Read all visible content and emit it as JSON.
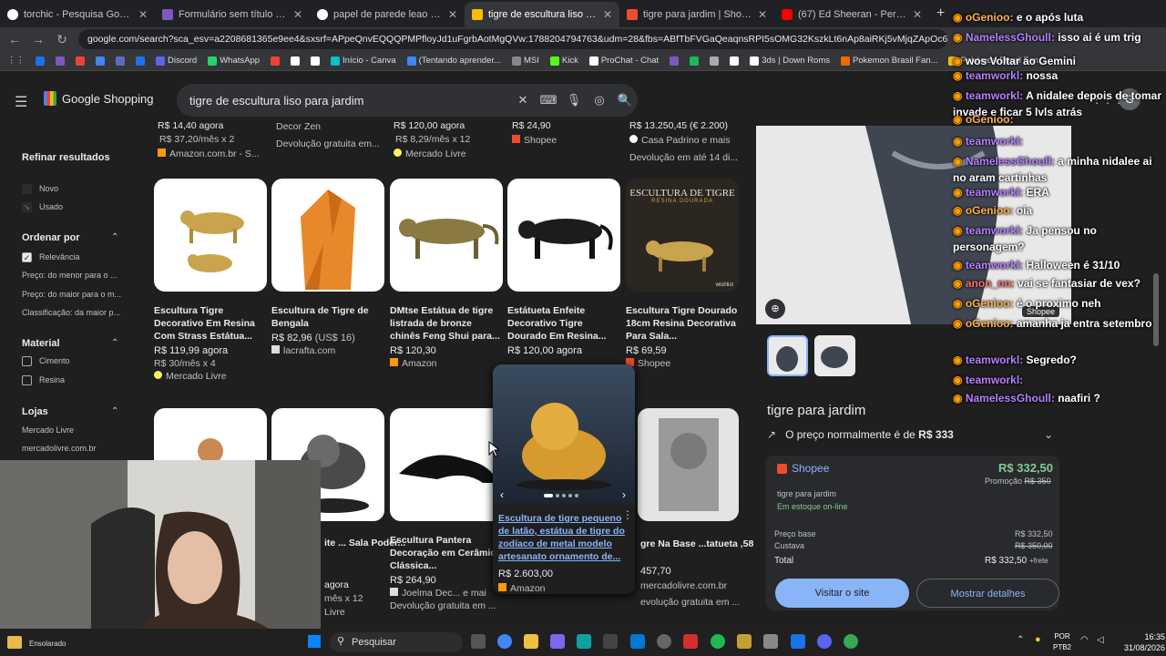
{
  "tabs": [
    {
      "title": "torchic - Pesquisa Google",
      "color": "#ffffff"
    },
    {
      "title": "Formulário sem título - Google",
      "color": "#7e57c2"
    },
    {
      "title": "papel de parede leao - Pesquis",
      "color": "#ffffff"
    },
    {
      "title": "tigre de escultura liso para jardi",
      "color": "#fbbc05",
      "active": true
    },
    {
      "title": "tigre para jardim | Shopee Brasi",
      "color": "#ee4d2d"
    },
    {
      "title": "(67) Ed Sheeran - Perfeita - You",
      "color": "#ff0000"
    }
  ],
  "address": "google.com/search?sca_esv=a2208681365e9ee4&sxsrf=APpeQnvEQQQPMPfloyJd1uFgrbAotMgQVw:1788204794763&udm=28&fbs=ABfTbFVGaQeaqnsRPI5sOMG32KszkLt6nAp8aiRKj5vMjqZApOc6yfvD6e0PKT-w9T4UNd5LfevPP...",
  "bookmarks": [
    {
      "label": "",
      "color": "#1a73e8"
    },
    {
      "label": "",
      "color": "#7e57c2"
    },
    {
      "label": "",
      "color": "#ea4335"
    },
    {
      "label": "",
      "color": "#4285f4"
    },
    {
      "label": "",
      "color": "#5c6bc0"
    },
    {
      "label": "",
      "color": "#1a73e8"
    },
    {
      "label": "Discord",
      "color": "#5865f2"
    },
    {
      "label": "WhatsApp",
      "color": "#25d366"
    },
    {
      "label": "",
      "color": "#ea4335"
    },
    {
      "label": "",
      "color": "#ffffff"
    },
    {
      "label": "",
      "color": "#ffffff"
    },
    {
      "label": "Início - Canva",
      "color": "#00c4cc"
    },
    {
      "label": "(Tentando aprender...",
      "color": "#4285f4"
    },
    {
      "label": "MSI",
      "color": "#888888"
    },
    {
      "label": "Kick",
      "color": "#53fc18"
    },
    {
      "label": "ProChat - Chat",
      "color": "#ffffff"
    },
    {
      "label": "",
      "color": "#7e57c2"
    },
    {
      "label": "",
      "color": "#1db954"
    },
    {
      "label": "",
      "color": "#aaaaaa"
    },
    {
      "label": "",
      "color": "#ffffff"
    },
    {
      "label": "3ds | Down Roms",
      "color": "#ffffff"
    },
    {
      "label": "Pokemon Brasil Fan...",
      "color": "#ef6c00"
    },
    {
      "label": "Pokémon Brasil Fan...",
      "color": "#fbbc05"
    }
  ],
  "header": {
    "logo_text": "Google Shopping",
    "query": "tigre de escultura liso para jardim",
    "avatar": "G"
  },
  "sidebar": {
    "refine_title": "Refinar resultados",
    "condition": [
      "Novo",
      "Usado"
    ],
    "sort_title": "Ordenar por",
    "sort": [
      "Relevância",
      "Preço: do menor para o ...",
      "Preço: do maior para o m...",
      "Classificação: da maior p..."
    ],
    "material_title": "Material",
    "material": [
      "Cimento",
      "Resina"
    ],
    "stores_title": "Lojas",
    "stores": [
      "Mercado Livre",
      "mercadolivre.com.br"
    ]
  },
  "top_partial": [
    {
      "price": "R$ 14,40 agora",
      "sub": "R$ 37,20/mês x 2",
      "seller": "Amazon.com.br - S..."
    },
    {
      "price": "",
      "sub": "Decor Zen",
      "seller": "Devolução gratuita em..."
    },
    {
      "price": "R$ 120,00 agora",
      "sub": "R$ 8,29/mês x 12",
      "seller": "Mercado Livre"
    },
    {
      "price": "R$ 24,90",
      "sub": "Shopee",
      "seller": ""
    },
    {
      "price": "R$ 13.250,45  (€ 2.200)",
      "sub": "Casa Padrino e mais",
      "seller": "Devolução em até 14 di..."
    }
  ],
  "row1": [
    {
      "title": "Escultura Tigre Decorativo Em Resina Com Strass Estátua...",
      "price": "R$ 119,99 agora",
      "sub": "R$ 30/mês x 4",
      "seller": "Mercado Livre"
    },
    {
      "title": "Escultura de Tigre de Bengala",
      "price": "R$ 82,96",
      "price_extra": "(US$ 16)",
      "sub": "lacrafta.com",
      "seller": ""
    },
    {
      "title": "DMtse Estátua de tigre listrada de bronze chinês Feng Shui para...",
      "price": "R$ 120,30",
      "sub": "Amazon",
      "seller": ""
    },
    {
      "title": "Estátueta Enfeite Decorativo Tigre Dourado Em Resina...",
      "price": "R$ 120,00 agora",
      "sub": "",
      "seller": ""
    },
    {
      "title": "Escultura Tigre Dourado 18cm Resina Decorativa Para Sala...",
      "price": "R$ 69,59",
      "sub": "Shopee",
      "seller": ""
    }
  ],
  "row1_overlay": {
    "line1": "ESCULTURA DE TIGRE",
    "line2": "RESINA DOURADA",
    "tag": "wishlist"
  },
  "row2": [
    {
      "title": "",
      "price": "",
      "sub": ""
    },
    {
      "title": "ite ... Sala Poder...",
      "price": "agora",
      "sub": "mês x 12",
      "seller": "Livre"
    },
    {
      "title": "Escultura Pantera Decoração em Cerâmica Clássica...",
      "price": "R$ 264,90",
      "sub": "Joelma Dec...",
      "sub2": "e mai",
      "seller": "Devolução gratuita em ..."
    },
    {
      "title": "gre Na Base ...tatueta ,58 Cm",
      "price": "457,70",
      "sub": "mercadolivre.com.br",
      "seller": "evolução gratuita em ..."
    }
  ],
  "hover_card": {
    "title": "Escultura de tigre pequeno de latão, estátua de tigre do zodíaco de metal modelo artesanato ornamento de...",
    "price": "R$ 2.603,00",
    "seller": "Amazon"
  },
  "panel": {
    "shop_tag": "Shopee",
    "name": "tigre para jardim",
    "normal_price_text": "O preço normalmente é de",
    "normal_price": "R$ 333",
    "store": "Shopee",
    "price": "R$ 332,50",
    "promo_label": "Promoção",
    "promo_old": "R$ 350",
    "item": "tigre para jardim",
    "stock": "Em estoque on-line",
    "base_label": "Preço base",
    "base_value": "R$ 332,50",
    "cost_label": "Custava",
    "cost_value": "R$ 350,00",
    "total_label": "Total",
    "total_value": "R$ 332,50",
    "shipping": "+frete",
    "visit": "Visitar o site",
    "details": "Mostrar detalhes",
    "accent": "#8ab4f8"
  },
  "chat": [
    {
      "user": "oGenioo:",
      "text": "e o após luta",
      "color": "#ffb14c"
    },
    {
      "user": "NamelessGhoull:",
      "text": "isso ai é um trig",
      "color": "#b780ff"
    },
    {
      "user": "wos",
      "text": "Voltar ao Gemini",
      "color": "#ffffff"
    },
    {
      "user": "teamworkl:",
      "text": "nossa",
      "color": "#b780ff"
    },
    {
      "user": "teamworkl:",
      "text": "A nidalee depois de tomar invade e ficar 5 lvls atrás",
      "color": "#b780ff"
    },
    {
      "user": "oGenioo:",
      "text": "",
      "color": "#ffb14c"
    },
    {
      "user": "teamworkl:",
      "text": "",
      "color": "#b780ff"
    },
    {
      "user": "NamelessGhoull:",
      "text": "a minha nidalee ai no aram cartinhas",
      "color": "#b780ff"
    },
    {
      "user": "teamworkl:",
      "text": "ERA",
      "color": "#b780ff"
    },
    {
      "user": "oGenioo:",
      "text": "oia",
      "color": "#ffb14c"
    },
    {
      "user": "teamworkl:",
      "text": "Ja pensou no personagem?",
      "color": "#b780ff"
    },
    {
      "user": "teamworkl:",
      "text": "Halloween é 31/10",
      "color": "#b780ff"
    },
    {
      "user": "anon_nn:",
      "text": "vai se fantasiar de vex?",
      "color": "#ff6b6b"
    },
    {
      "user": "oGenioo:",
      "text": "é o proximo neh",
      "color": "#ffb14c"
    },
    {
      "user": "oGenioo:",
      "text": "amanha ja entra setembro",
      "color": "#ffb14c"
    },
    {
      "user": "teamworkl:",
      "text": "Segredo?",
      "color": "#b780ff"
    },
    {
      "user": "teamworkl:",
      "text": "",
      "color": "#b780ff"
    },
    {
      "user": "NamelessGhoull:",
      "text": "naafiri ?",
      "color": "#b780ff"
    }
  ],
  "webcam": {
    "label": "Ensolarado"
  },
  "taskbar": {
    "search": "Pesquisar",
    "lang1": "POR",
    "lang2": "PTB2",
    "time": "16:35",
    "date": "31/08/2026"
  }
}
